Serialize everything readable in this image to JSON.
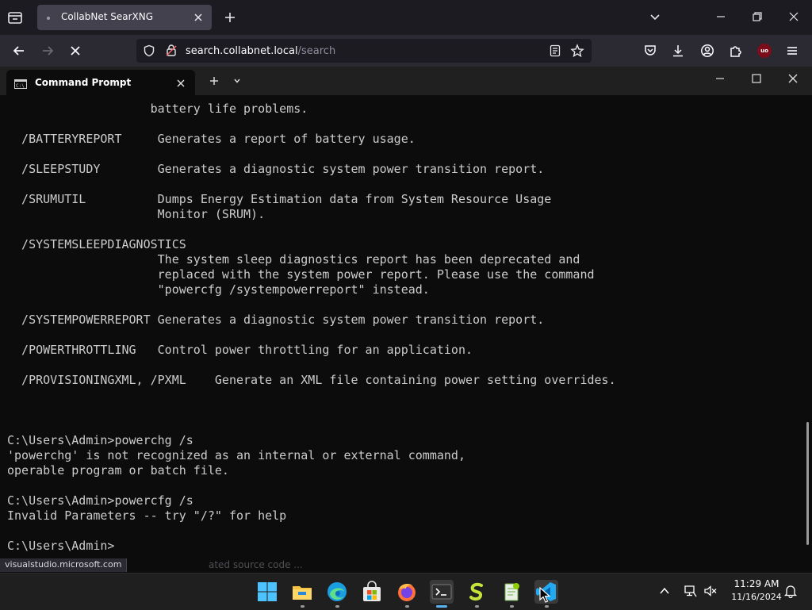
{
  "browser": {
    "tab_title": "CollabNet SearXNG",
    "url_host": "search.collabnet.local",
    "url_path": "/search",
    "ublock_badge": "uo"
  },
  "terminal": {
    "tab_title": "Command Prompt",
    "lines": [
      "                    battery life problems.",
      "",
      "  /BATTERYREPORT     Generates a report of battery usage.",
      "",
      "  /SLEEPSTUDY        Generates a diagnostic system power transition report.",
      "",
      "  /SRUMUTIL          Dumps Energy Estimation data from System Resource Usage",
      "                     Monitor (SRUM).",
      "",
      "  /SYSTEMSLEEPDIAGNOSTICS",
      "                     The system sleep diagnostics report has been deprecated and",
      "                     replaced with the system power report. Please use the command",
      "                     \"powercfg /systempowerreport\" instead.",
      "",
      "  /SYSTEMPOWERREPORT Generates a diagnostic system power transition report.",
      "",
      "  /POWERTHROTTLING   Control power throttling for an application.",
      "",
      "  /PROVISIONINGXML, /PXML    Generate an XML file containing power setting overrides.",
      "",
      "",
      "",
      "C:\\Users\\Admin>powerchg /s",
      "'powerchg' is not recognized as an internal or external command,",
      "operable program or batch file.",
      "",
      "C:\\Users\\Admin>powercfg /s",
      "Invalid Parameters -- try \"/?\" for help",
      "",
      "C:\\Users\\Admin>"
    ]
  },
  "status": {
    "link": "visualstudio.microsoft.com",
    "faded_text": "ated source code ..."
  },
  "taskbar": {
    "time": "11:29 AM",
    "date": "11/16/2024"
  },
  "colors": {
    "console_bg": "#0c0c0c",
    "console_fg": "#cccccc",
    "browser_bg": "#1c1b22",
    "accent": "#5ab3f0"
  }
}
